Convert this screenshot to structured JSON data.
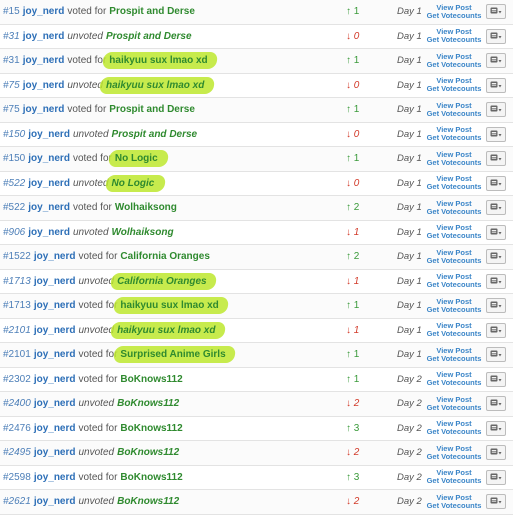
{
  "rows": [
    {
      "num": "#15",
      "num_italic": false,
      "user": "joy_nerd",
      "verb": "voted for",
      "choice": "Prospit and Derse",
      "highlight": false,
      "delta": "↑ 1",
      "dir": "up",
      "day": "Day 1"
    },
    {
      "num": "#31",
      "num_italic": true,
      "user": "joy_nerd",
      "verb": "unvoted",
      "choice": "Prospit and Derse",
      "highlight": false,
      "delta": "↓ 0",
      "dir": "down",
      "day": "Day 1"
    },
    {
      "num": "#31",
      "num_italic": false,
      "user": "joy_nerd",
      "verb": "voted for",
      "choice": "haikyuu sux lmao xd",
      "highlight": true,
      "delta": "↑ 1",
      "dir": "up",
      "day": "Day 1"
    },
    {
      "num": "#75",
      "num_italic": true,
      "user": "joy_nerd",
      "verb": "unvoted",
      "choice": "haikyuu sux lmao xd",
      "highlight": true,
      "delta": "↓ 0",
      "dir": "down",
      "day": "Day 1"
    },
    {
      "num": "#75",
      "num_italic": false,
      "user": "joy_nerd",
      "verb": "voted for",
      "choice": "Prospit and Derse",
      "highlight": false,
      "delta": "↑ 1",
      "dir": "up",
      "day": "Day 1"
    },
    {
      "num": "#150",
      "num_italic": true,
      "user": "joy_nerd",
      "verb": "unvoted",
      "choice": "Prospit and Derse",
      "highlight": false,
      "delta": "↓ 0",
      "dir": "down",
      "day": "Day 1"
    },
    {
      "num": "#150",
      "num_italic": false,
      "user": "joy_nerd",
      "verb": "voted for",
      "choice": "No Logic",
      "highlight": true,
      "delta": "↑ 1",
      "dir": "up",
      "day": "Day 1"
    },
    {
      "num": "#522",
      "num_italic": true,
      "user": "joy_nerd",
      "verb": "unvoted",
      "choice": "No Logic",
      "highlight": true,
      "delta": "↓ 0",
      "dir": "down",
      "day": "Day 1"
    },
    {
      "num": "#522",
      "num_italic": false,
      "user": "joy_nerd",
      "verb": "voted for",
      "choice": "Wolhaiksong",
      "highlight": false,
      "delta": "↑ 2",
      "dir": "up",
      "day": "Day 1"
    },
    {
      "num": "#906",
      "num_italic": true,
      "user": "joy_nerd",
      "verb": "unvoted",
      "choice": "Wolhaiksong",
      "highlight": false,
      "delta": "↓ 1",
      "dir": "down",
      "day": "Day 1"
    },
    {
      "num": "#1522",
      "num_italic": false,
      "user": "joy_nerd",
      "verb": "voted for",
      "choice": "California Oranges",
      "highlight": false,
      "delta": "↑ 2",
      "dir": "up",
      "day": "Day 1"
    },
    {
      "num": "#1713",
      "num_italic": true,
      "user": "joy_nerd",
      "verb": "unvoted",
      "choice": "California Oranges",
      "highlight": true,
      "delta": "↓ 1",
      "dir": "down",
      "day": "Day 1"
    },
    {
      "num": "#1713",
      "num_italic": false,
      "user": "joy_nerd",
      "verb": "voted for",
      "choice": "haikyuu sux lmao xd",
      "highlight": true,
      "delta": "↑ 1",
      "dir": "up",
      "day": "Day 1"
    },
    {
      "num": "#2101",
      "num_italic": true,
      "user": "joy_nerd",
      "verb": "unvoted",
      "choice": "haikyuu sux lmao xd",
      "highlight": true,
      "delta": "↓ 1",
      "dir": "down",
      "day": "Day 1"
    },
    {
      "num": "#2101",
      "num_italic": false,
      "user": "joy_nerd",
      "verb": "voted for",
      "choice": "Surprised Anime Girls",
      "highlight": true,
      "delta": "↑ 1",
      "dir": "up",
      "day": "Day 1"
    },
    {
      "num": "#2302",
      "num_italic": false,
      "user": "joy_nerd",
      "verb": "voted for",
      "choice": "BoKnows112",
      "highlight": false,
      "delta": "↑ 1",
      "dir": "up",
      "day": "Day 2"
    },
    {
      "num": "#2400",
      "num_italic": true,
      "user": "joy_nerd",
      "verb": "unvoted",
      "choice": "BoKnows112",
      "highlight": false,
      "delta": "↓ 2",
      "dir": "down",
      "day": "Day 2"
    },
    {
      "num": "#2476",
      "num_italic": false,
      "user": "joy_nerd",
      "verb": "voted for",
      "choice": "BoKnows112",
      "highlight": false,
      "delta": "↑ 3",
      "dir": "up",
      "day": "Day 2"
    },
    {
      "num": "#2495",
      "num_italic": true,
      "user": "joy_nerd",
      "verb": "unvoted",
      "choice": "BoKnows112",
      "highlight": false,
      "delta": "↓ 2",
      "dir": "down",
      "day": "Day 2"
    },
    {
      "num": "#2598",
      "num_italic": false,
      "user": "joy_nerd",
      "verb": "voted for",
      "choice": "BoKnows112",
      "highlight": false,
      "delta": "↑ 3",
      "dir": "up",
      "day": "Day 2"
    },
    {
      "num": "#2621",
      "num_italic": true,
      "user": "joy_nerd",
      "verb": "unvoted",
      "choice": "BoKnows112",
      "highlight": false,
      "delta": "↓ 2",
      "dir": "down",
      "day": "Day 2"
    }
  ],
  "links": {
    "view_post": "View Post",
    "get_votecounts": "Get Votecounts"
  },
  "icons": {
    "row_button": "vote-history-icon"
  },
  "colors": {
    "user": "#2d6fb7",
    "choice": "#2f8a2f",
    "up": "#3a9a3a",
    "down": "#d23b2a",
    "highlight": "#bde82e",
    "link": "#3c86c8"
  }
}
